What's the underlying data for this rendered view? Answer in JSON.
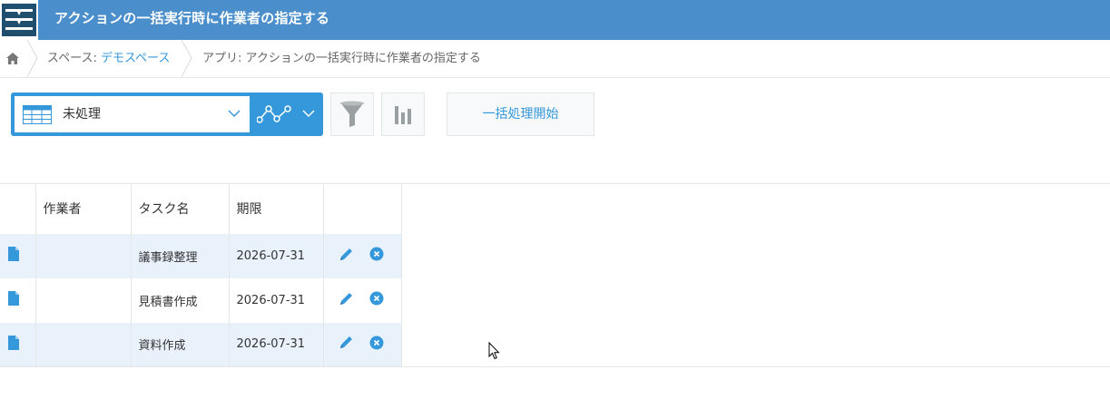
{
  "header": {
    "title": "アクションの一括実行時に作業者の指定する"
  },
  "breadcrumb": {
    "space_label": "スペース: ",
    "space_name": "デモスペース",
    "app_label": "アプリ: アクションの一括実行時に作業者の指定する"
  },
  "toolbar": {
    "view_name": "未処理",
    "bulk_button_label": "一括処理開始"
  },
  "table": {
    "columns": [
      "",
      "作業者",
      "タスク名",
      "期限",
      ""
    ],
    "rows": [
      {
        "worker": "",
        "task": "議事録整理",
        "due": "2026-07-31"
      },
      {
        "worker": "",
        "task": "見積書作成",
        "due": "2026-07-31"
      },
      {
        "worker": "",
        "task": "資料作成",
        "due": "2026-07-31"
      }
    ]
  },
  "colors": {
    "header_bg": "#4a8ecb",
    "accent": "#3498db",
    "row_highlight": "#e9f2fb",
    "border": "#e3e7e8"
  },
  "icons": [
    "app-menu-icon",
    "home-icon",
    "list-view-icon",
    "chevron-down-icon",
    "graph-icon",
    "filter-icon",
    "bar-chart-icon",
    "document-icon",
    "edit-icon",
    "delete-icon",
    "mouse-cursor-icon"
  ]
}
